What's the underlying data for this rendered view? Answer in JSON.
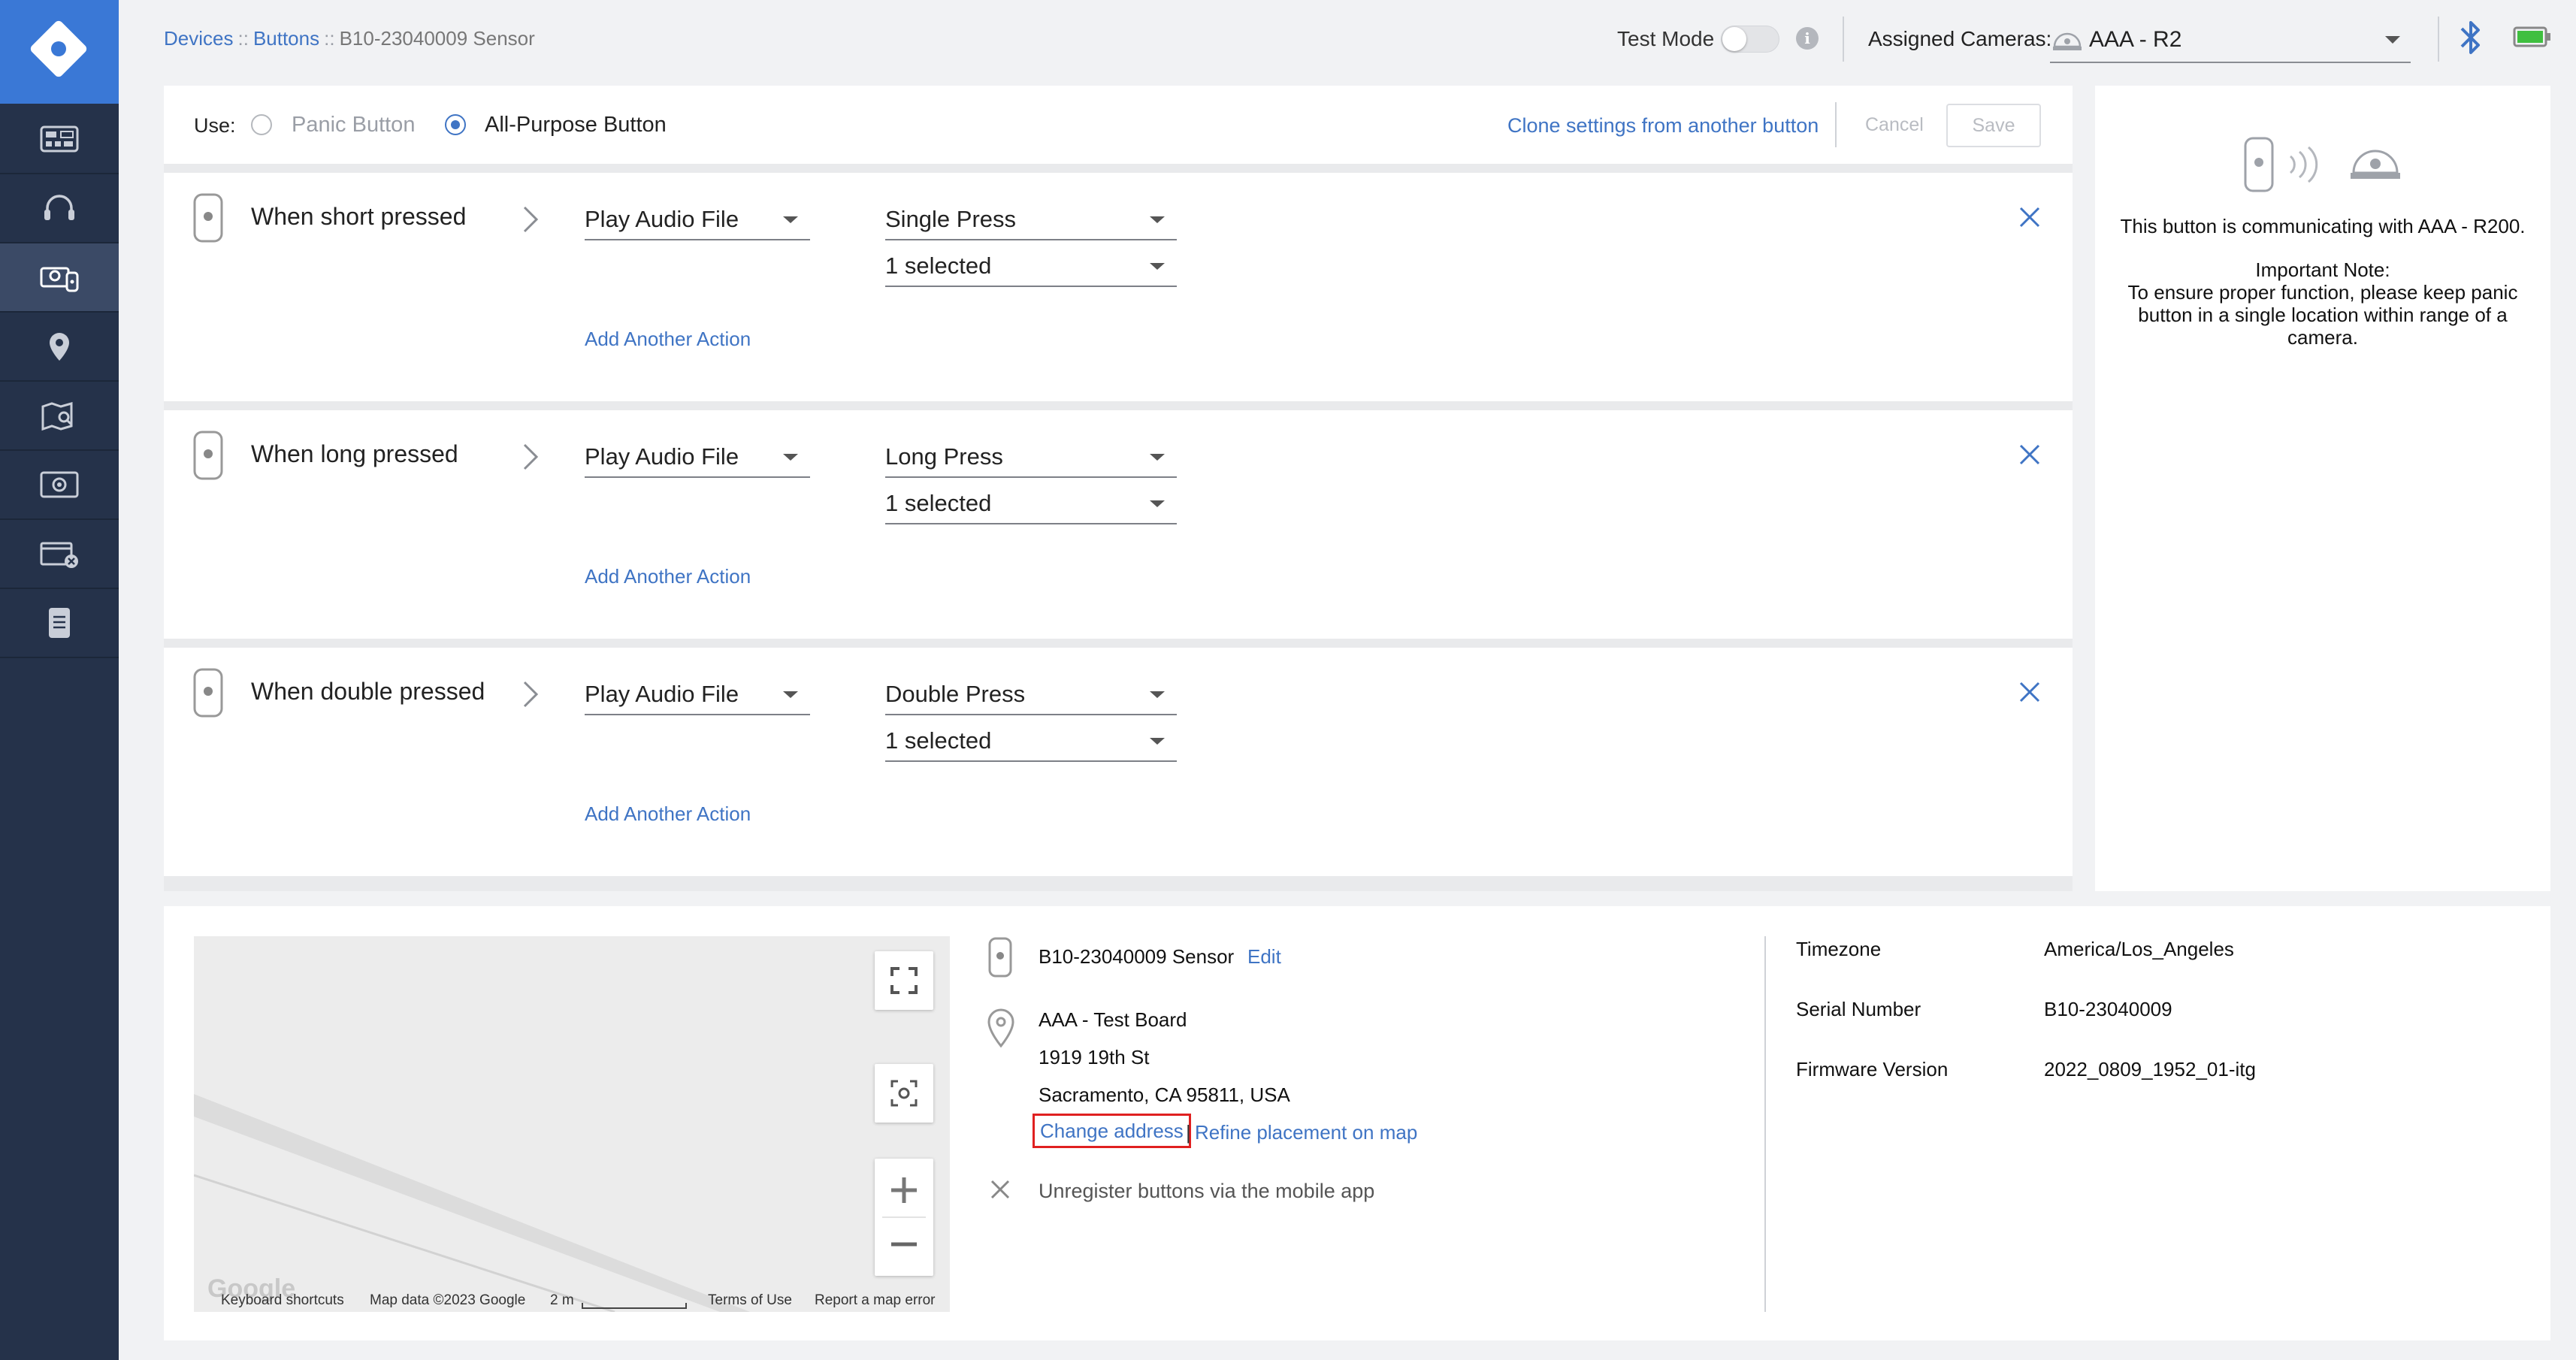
{
  "breadcrumb": {
    "devices": "Devices",
    "buttons": "Buttons",
    "sep": "::",
    "current": "B10-23040009 Sensor"
  },
  "topbar": {
    "test_mode_label": "Test Mode",
    "test_mode_on": false,
    "info_glyph": "i",
    "assigned_cameras_label": "Assigned Cameras:",
    "assigned_camera_value": "AAA - R2"
  },
  "use": {
    "label": "Use:",
    "options": [
      "Panic Button",
      "All-Purpose Button"
    ],
    "selected": "All-Purpose Button",
    "clone_link": "Clone settings from another button",
    "cancel_label": "Cancel",
    "save_label": "Save"
  },
  "actions": [
    {
      "title": "When short pressed",
      "action": "Play Audio File",
      "trigger": "Single Press",
      "selected": "1 selected",
      "add_label": "Add Another Action"
    },
    {
      "title": "When long pressed",
      "action": "Play Audio File",
      "trigger": "Long Press",
      "selected": "1 selected",
      "add_label": "Add Another Action"
    },
    {
      "title": "When double pressed",
      "action": "Play Audio File",
      "trigger": "Double Press",
      "selected": "1 selected",
      "add_label": "Add Another Action"
    }
  ],
  "info_panel": {
    "communicating": "This button is communicating with AAA - R200.",
    "note_title": "Important Note:",
    "note_body": "To ensure proper function, please keep panic button in a single location within range of a camera."
  },
  "map": {
    "footer": {
      "keyboard": "Keyboard shortcuts",
      "map_data": "Map data ©2023 Google",
      "scale": "2 m",
      "terms": "Terms of Use",
      "report": "Report a map error"
    },
    "logo_text": "Google"
  },
  "details": {
    "sensor_name": "B10-23040009 Sensor",
    "edit_label": "Edit",
    "address_lines": [
      "AAA - Test Board",
      "1919 19th St",
      "Sacramento, CA 95811, USA"
    ],
    "change_address": "Change address",
    "separator": "|",
    "refine_placement": "Refine placement on map",
    "unregister": "Unregister buttons via the mobile app",
    "timezone_label": "Timezone",
    "timezone_value": "America/Los_Angeles",
    "serial_label": "Serial Number",
    "serial_value": "B10-23040009",
    "firmware_label": "Firmware Version",
    "firmware_value": "2022_0809_1952_01-itg"
  },
  "colors": {
    "sidebar": "#25324a",
    "logo": "#3a78d6",
    "link": "#3f74c4",
    "highlight_border": "#e02020",
    "battery": "#3fbf3f"
  },
  "icons": {
    "sidebar": [
      "dashboard-icon",
      "headset-icon",
      "devices-icon",
      "location-pin-icon",
      "map-icon",
      "camera-settings-icon",
      "video-icon",
      "document-icon"
    ]
  }
}
